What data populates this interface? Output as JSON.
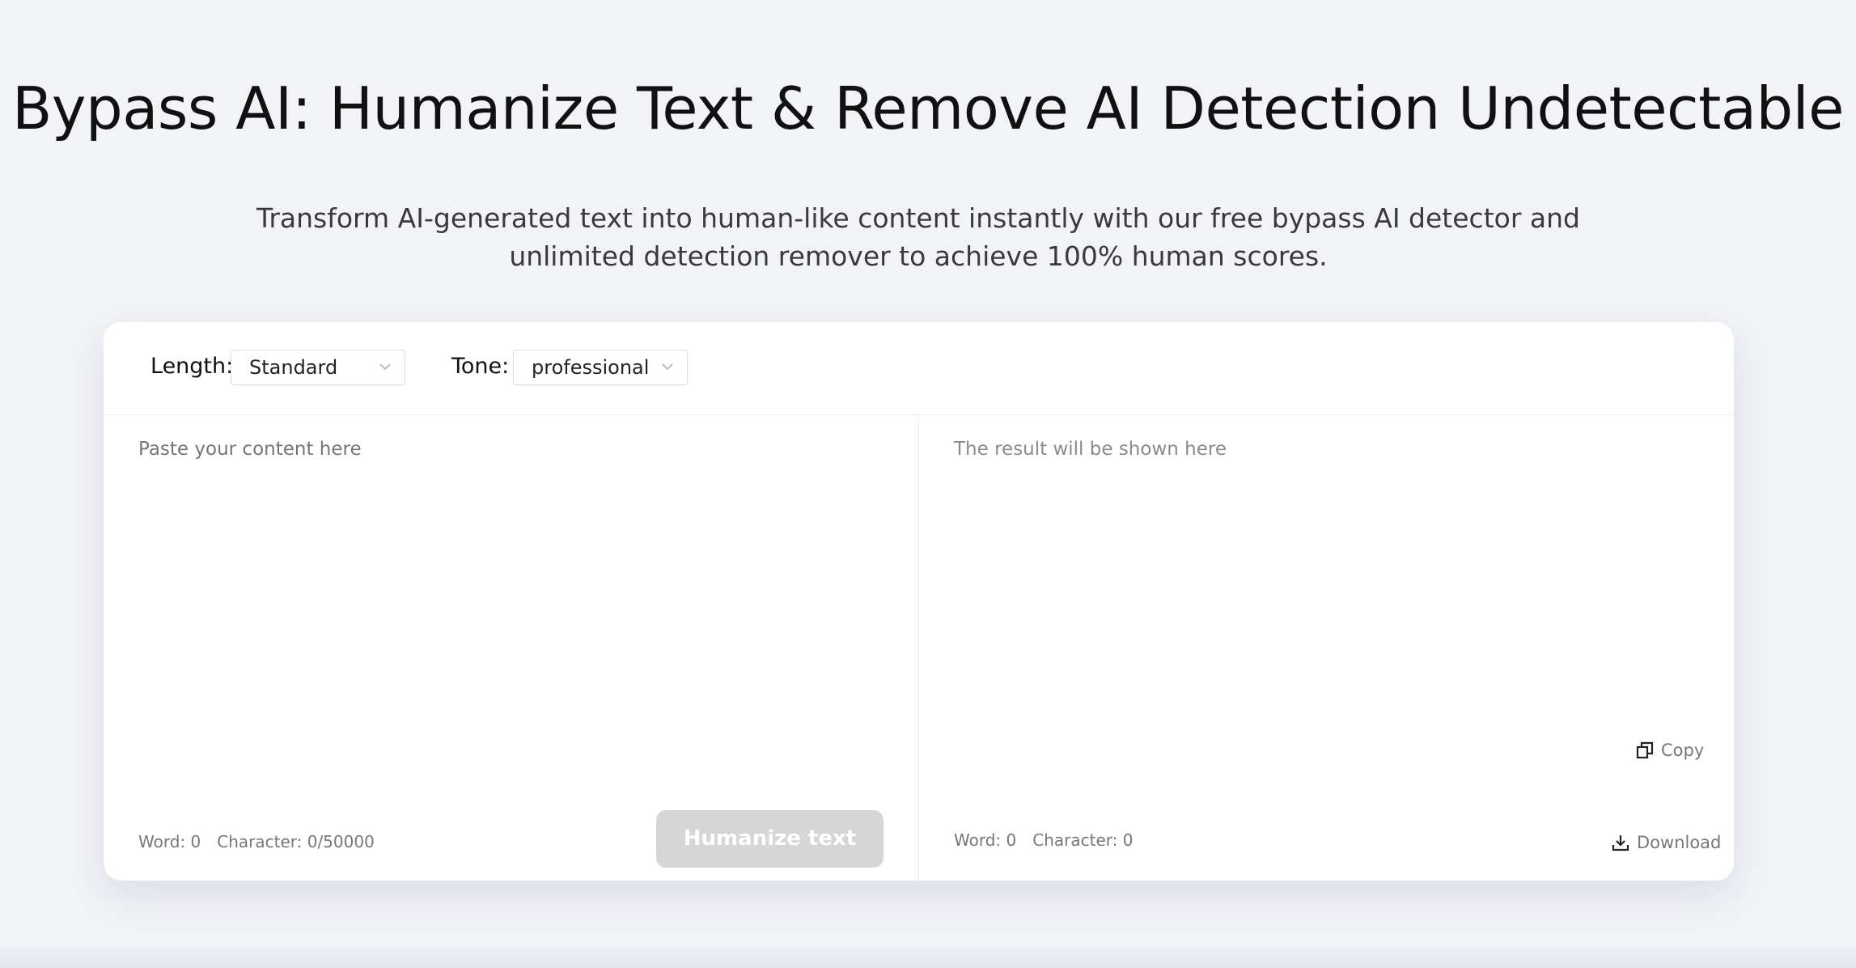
{
  "hero": {
    "title": "Bypass AI: Humanize Text & Remove AI Detection Undetectable",
    "subtitle": "Transform AI-generated text into human-like content instantly with our free bypass AI detector and unlimited detection remover to achieve 100% human scores."
  },
  "toolbar": {
    "length_label": "Length:",
    "length_value": "Standard",
    "tone_label": "Tone:",
    "tone_value": "professional"
  },
  "input_pane": {
    "placeholder": "Paste your content here",
    "word_count": "Word: 0",
    "char_count": "Character: 0/50000",
    "humanize_label": "Humanize text"
  },
  "output_pane": {
    "placeholder": "The result will be shown here",
    "word_count": "Word: 0",
    "char_count": "Character: 0",
    "download_label": "Download",
    "copy_label": "Copy"
  },
  "colors": {
    "background": "#f2f3f7",
    "card": "#ffffff",
    "button_disabled": "#d6d6d6"
  },
  "icons": [
    "chevron-down-icon",
    "download-icon",
    "copy-icon"
  ]
}
